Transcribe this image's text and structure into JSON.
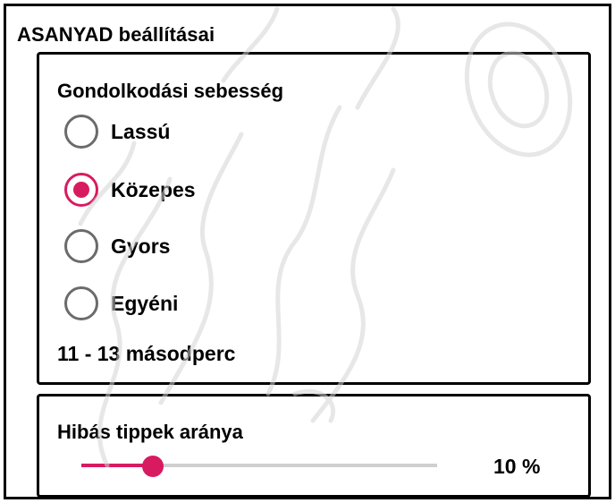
{
  "app": {
    "title": "ASANYAD beállításai"
  },
  "speed": {
    "title": "Gondolkodási sebesség",
    "options": [
      {
        "label": "Lassú",
        "checked": false
      },
      {
        "label": "Közepes",
        "checked": true
      },
      {
        "label": "Gyors",
        "checked": false
      },
      {
        "label": "Egyéni",
        "checked": false
      }
    ],
    "duration": "11 - 13 másodperc"
  },
  "error_rate": {
    "title": "Hibás tippek aránya",
    "value": 0.2,
    "value_label": "10 %"
  },
  "colors": {
    "accent": "#d81b60",
    "radio_off": "#6b6b6b",
    "track": "#cfcfcf"
  }
}
